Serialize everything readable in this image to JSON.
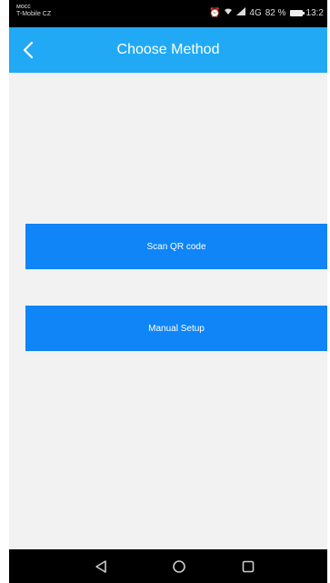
{
  "status_bar": {
    "carrier_line1": "ᴍᴏᴄᴄ",
    "carrier_line2": "T-Mobile CZ",
    "signal_text": "4G",
    "battery_percent": "82 %",
    "time": "13:2"
  },
  "header": {
    "title": "Choose Method",
    "back_icon": "chevron-left-icon"
  },
  "buttons": {
    "scan_label": "Scan QR code",
    "manual_label": "Manual Setup"
  },
  "nav_bar": {
    "back_icon": "triangle-back-icon",
    "home_icon": "circle-home-icon",
    "recent_icon": "square-recent-icon"
  },
  "colors": {
    "header_bg": "#22a9f5",
    "button_bg": "#0f85f7",
    "screen_bg": "#f2f2f2",
    "bar_bg": "#000000"
  }
}
